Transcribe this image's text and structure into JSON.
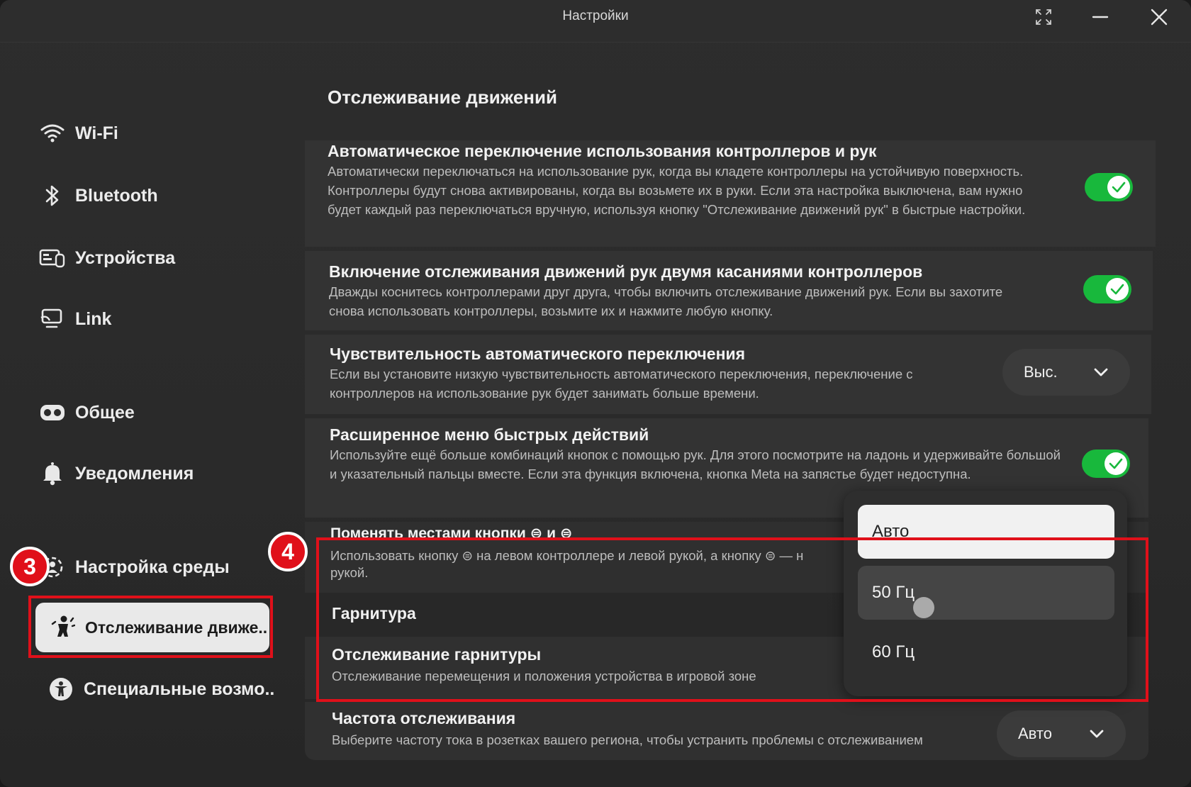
{
  "window": {
    "title": "Настройки"
  },
  "sidebar": {
    "items": [
      {
        "label": "Wi-Fi",
        "icon": "wifi-icon"
      },
      {
        "label": "Bluetooth",
        "icon": "bluetooth-icon"
      },
      {
        "label": "Устройства",
        "icon": "devices-icon"
      },
      {
        "label": "Link",
        "icon": "link-icon"
      },
      {
        "label": "Общее",
        "icon": "headset-icon"
      },
      {
        "label": "Уведомления",
        "icon": "bell-icon"
      },
      {
        "label": "Настройка среды",
        "icon": "environment-icon"
      },
      {
        "label": "Отслеживание движе..",
        "icon": "movement-tracking-icon",
        "active": true
      },
      {
        "label": "Специальные возмо..",
        "icon": "accessibility-icon"
      }
    ]
  },
  "annotations": {
    "badge_3": "3",
    "badge_4": "4",
    "accent": "#e0101a"
  },
  "main": {
    "title": "Отслеживание движений",
    "rows": [
      {
        "title": "Автоматическое переключение использования контроллеров и рук",
        "desc": "Автоматически переключаться на использование рук, когда вы кладете контроллеры на устойчивую поверхность. Контроллеры будут снова активированы, когда вы возьмете их в руки. Если эта настройка выключена, вам нужно будет каждый раз переключаться вручную, используя кнопку \"Отслеживание движений рук\" в быстрые настройки.",
        "toggle": true
      },
      {
        "title": "Включение отслеживания движений рук двумя касаниями контроллеров",
        "desc": "Дважды коснитесь контроллерами друг друга, чтобы включить отслеживание движений рук. Если вы захотите снова использовать контроллеры, возьмите их и нажмите любую кнопку.",
        "toggle": true
      },
      {
        "title": "Чувствительность автоматического переключения",
        "desc": "Если вы установите низкую чувствительность автоматического переключения, переключение с контроллеров на использование рук будет занимать больше времени.",
        "select": "Выс."
      },
      {
        "title": "Расширенное меню быстрых действий",
        "desc": "Используйте ещё больше комбинаций кнопок с помощью рук. Для этого посмотрите на ладонь и удерживайте большой и указательный пальцы вместе. Если эта функция включена, кнопка Meta на запястье будет недоступна.",
        "toggle": true
      },
      {
        "title": "Поменять местами кнопки ⊜ и ⊜",
        "desc_line1": "Использовать кнопку ⊜ на левом контроллере и левой рукой, а кнопку ⊜ — н",
        "desc_line2": "рукой."
      }
    ],
    "section_headset": "Гарнитура",
    "headset_tracking": {
      "title": "Отслеживание гарнитуры",
      "desc": "Отслеживание перемещения и положения устройства в игровой зоне"
    },
    "tracking_frequency": {
      "title": "Частота отслеживания",
      "desc": "Выберите частоту тока в розетках вашего региона, чтобы устранить проблемы с отслеживанием",
      "select": "Авто"
    }
  },
  "dropdown": {
    "options": [
      "Авто",
      "50 Гц",
      "60 Гц"
    ],
    "selected": "Авто",
    "hovered": "50 Гц"
  },
  "colors": {
    "toggle_on": "#18b83c"
  }
}
